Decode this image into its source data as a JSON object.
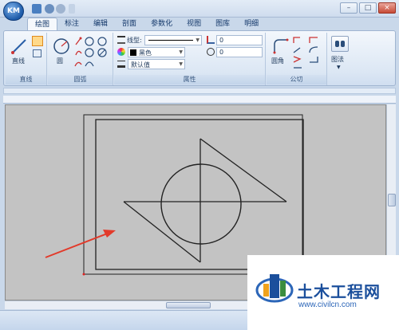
{
  "app": {
    "logo_text": "KM"
  },
  "tabs": [
    "绘图",
    "标注",
    "编辑",
    "剖面",
    "参数化",
    "视图",
    "图库",
    "明细"
  ],
  "active_tab": 0,
  "ribbon": {
    "line_group": {
      "label": "直线",
      "line_button": "直线"
    },
    "arc_group": {
      "label": "圆弧",
      "circle_button": "圆"
    },
    "properties_group": {
      "label": "属性",
      "linetype_label": "线型:",
      "color_value": "黑色",
      "lineweight_value": "默认值",
      "angle_value": "0",
      "rotation_value": "0"
    },
    "common_group": {
      "label": "公切",
      "fillet_button": "圆角"
    },
    "view_group": {
      "label": "",
      "button": "图法"
    }
  },
  "watermark": {
    "title": "土木工程网",
    "url": "www.civilcn.com"
  },
  "colors": {
    "accent": "#1b4f9c",
    "canvas": "#c3c3c3",
    "arrow": "#e23a2a"
  }
}
